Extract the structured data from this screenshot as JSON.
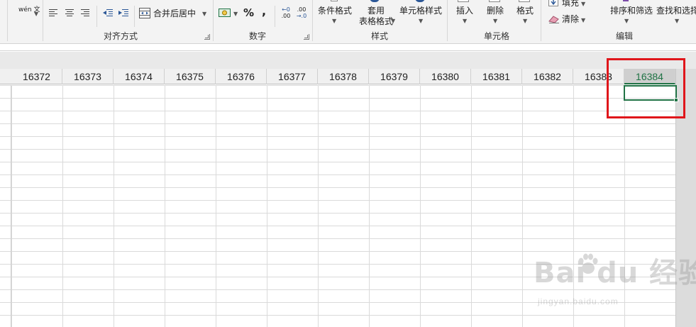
{
  "ribbon": {
    "wrap_text_label": "wén 文",
    "alignment": {
      "merge_center_label": "合并后居中",
      "group_label": "对齐方式"
    },
    "number": {
      "percent_label": "%",
      "comma_label": ",",
      "increase_decimal_top": "←0",
      "increase_decimal_bottom": ".00",
      "decrease_decimal_top": ".00",
      "decrease_decimal_bottom": "→.0",
      "group_label": "数字"
    },
    "styles": {
      "conditional_format_label": "条件格式",
      "format_table_line1": "套用",
      "format_table_line2": "表格格式",
      "cell_styles_label": "单元格样式",
      "group_label": "样式"
    },
    "cells": {
      "insert_label": "插入",
      "delete_label": "删除",
      "format_label": "格式",
      "group_label": "单元格"
    },
    "editing": {
      "fill_label": "填充",
      "clear_label": "清除",
      "sort_filter_label": "排序和筛选",
      "find_select_label": "查找和选择",
      "group_label": "编辑"
    }
  },
  "sheet": {
    "columns": [
      "16372",
      "16373",
      "16374",
      "16375",
      "16376",
      "16377",
      "16378",
      "16379",
      "16380",
      "16381",
      "16382",
      "16383",
      "16384"
    ],
    "selected_column": "16384"
  },
  "watermark": {
    "logo_text": "Bai du 经验",
    "url": "jingyan.baidu.com"
  },
  "colors": {
    "accent_green": "#217346",
    "highlight_red": "#e0161b"
  }
}
